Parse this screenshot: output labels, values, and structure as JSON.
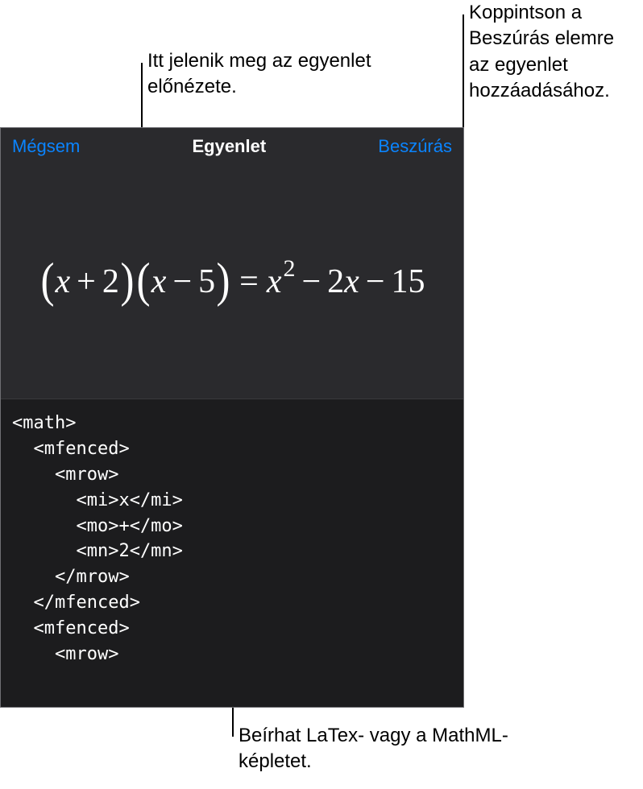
{
  "callouts": {
    "top_left": "Itt jelenik meg az\negyenlet előnézete.",
    "top_right": "Koppintson a\nBeszúrás elemre\naz egyenlet\nhozzáadásához.",
    "bottom": "Beírhat LaTex- vagy a\nMathML-képletet."
  },
  "navbar": {
    "cancel": "Mégsem",
    "title": "Egyenlet",
    "insert": "Beszúrás"
  },
  "equation": {
    "lhs_group1_var": "x",
    "lhs_group1_op": "+",
    "lhs_group1_num": "2",
    "lhs_group2_var": "x",
    "lhs_group2_op": "−",
    "lhs_group2_num": "5",
    "eq": "=",
    "rhs_var1": "x",
    "rhs_exp": "2",
    "rhs_op1": "−",
    "rhs_num1": "2",
    "rhs_var2": "x",
    "rhs_op2": "−",
    "rhs_num2": "15"
  },
  "code": "<math>\n  <mfenced>\n    <mrow>\n      <mi>x</mi>\n      <mo>+</mo>\n      <mn>2</mn>\n    </mrow>\n  </mfenced>\n  <mfenced>\n    <mrow>"
}
